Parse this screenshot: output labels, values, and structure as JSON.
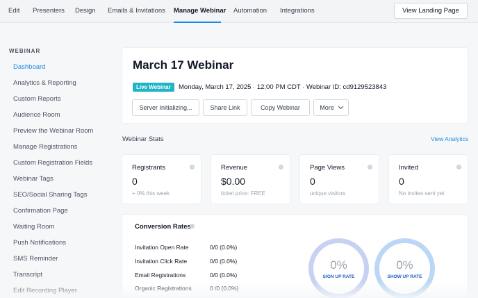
{
  "topnav": {
    "tabs": [
      {
        "label": "Edit",
        "active": false
      },
      {
        "label": "Presenters",
        "active": false
      },
      {
        "label": "Design",
        "active": false
      },
      {
        "label": "Emails & Invitations",
        "active": false
      },
      {
        "label": "Manage Webinar",
        "active": true
      },
      {
        "label": "Automation",
        "active": false
      },
      {
        "label": "Integrations",
        "active": false
      }
    ],
    "landing_button": "View Landing Page"
  },
  "sidebar": {
    "heading": "WEBINAR",
    "items": [
      {
        "label": "Dashboard",
        "active": true
      },
      {
        "label": "Analytics & Reporting"
      },
      {
        "label": "Custom Reports"
      },
      {
        "label": "Audience Room"
      },
      {
        "label": "Preview the Webinar Room"
      },
      {
        "label": "Manage Registrations"
      },
      {
        "label": "Custom Registration Fields"
      },
      {
        "label": "Webinar Tags"
      },
      {
        "label": "SEO/Social Sharing Tags"
      },
      {
        "label": "Confirmation Page"
      },
      {
        "label": "Waiting Room"
      },
      {
        "label": "Push Notifications"
      },
      {
        "label": "SMS Reminder"
      },
      {
        "label": "Transcript"
      },
      {
        "label": "Edit Recording Player"
      }
    ]
  },
  "header": {
    "title": "March 17 Webinar",
    "badge": "Live Webinar",
    "meta": "Monday, March 17, 2025 · 12:00 PM CDT · Webinar ID: cd9129523843",
    "buttons": {
      "server": "Server Initializing...",
      "share": "Share Link",
      "copy": "Copy Webinar",
      "more": "More"
    }
  },
  "stats": {
    "title": "Webinar Stats",
    "view_analytics": "View Analytics",
    "cards": [
      {
        "label": "Registrants",
        "value": "0",
        "sub": "+ 0% this week"
      },
      {
        "label": "Revenue",
        "value": "$0.00",
        "sub": "ticket price: FREE"
      },
      {
        "label": "Page Views",
        "value": "0",
        "sub": "unique visitors"
      },
      {
        "label": "Invited",
        "value": "0",
        "sub": "No invites sent yet"
      }
    ]
  },
  "conversion": {
    "title": "Conversion Rates",
    "rows": [
      {
        "label": "Invitation Open Rate",
        "value": "0/0 (0.0%)"
      },
      {
        "label": "Invitation Click Rate",
        "value": "0/0 (0.0%)"
      },
      {
        "label": "Email Registrations",
        "value": "0/0 (0.0%)"
      },
      {
        "label": "Organic Registrations",
        "value": "0 /0 (0.0%)"
      }
    ],
    "rings": [
      {
        "value": "0%",
        "label": "SIGN UP RATE"
      },
      {
        "value": "0%",
        "label": "SHOW UP RATE"
      }
    ]
  },
  "colors": {
    "accent": "#1e88e5",
    "badge": "#1fb5c6"
  }
}
